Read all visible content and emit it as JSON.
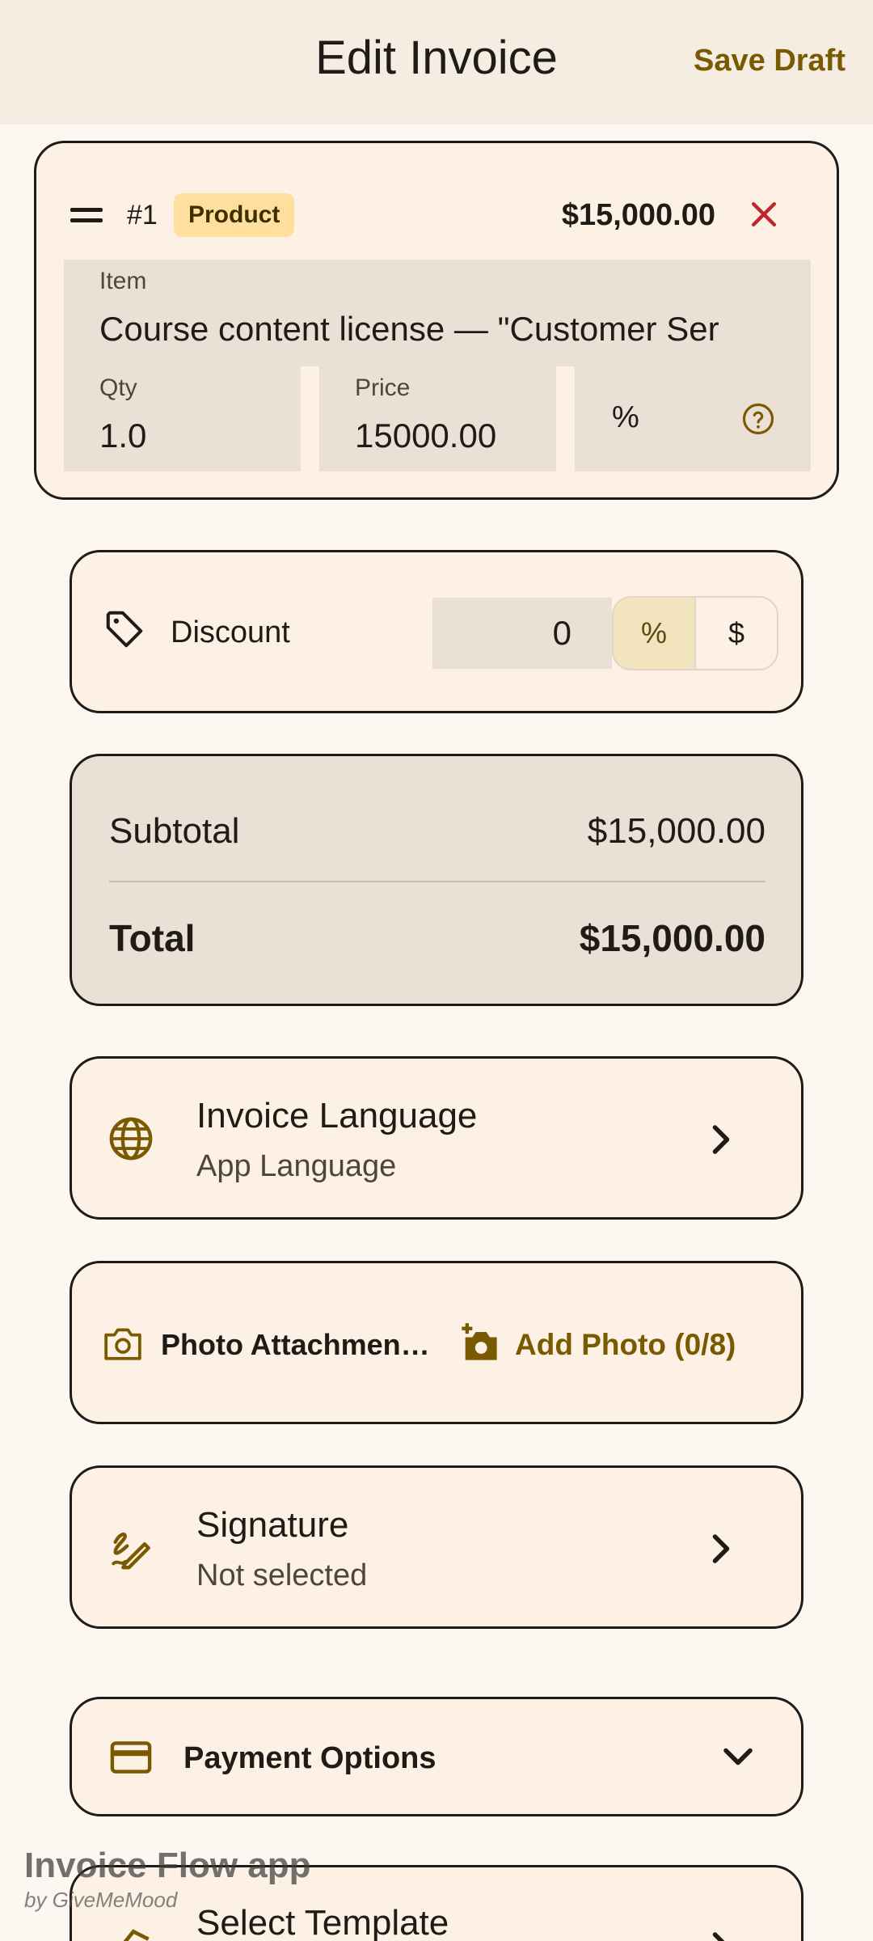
{
  "header": {
    "title": "Edit Invoice",
    "save_draft": "Save Draft"
  },
  "item": {
    "number": "#1",
    "type_badge": "Product",
    "amount": "$15,000.00",
    "item_label": "Item",
    "item_value": "Course content license — \"Customer Ser",
    "qty_label": "Qty",
    "qty_value": "1.0",
    "price_label": "Price",
    "price_value": "15000.00",
    "tax_symbol": "%"
  },
  "discount": {
    "label": "Discount",
    "value": "0",
    "pct": "%",
    "usd": "$"
  },
  "totals": {
    "subtotal_label": "Subtotal",
    "subtotal_value": "$15,000.00",
    "total_label": "Total",
    "total_value": "$15,000.00"
  },
  "language": {
    "title": "Invoice Language",
    "subtitle": "App Language"
  },
  "photos": {
    "title": "Photo Attachmen…",
    "add_label": "Add Photo (0/8)"
  },
  "signature": {
    "title": "Signature",
    "subtitle": "Not selected"
  },
  "payment": {
    "title": "Payment Options"
  },
  "template": {
    "title": "Select Template"
  },
  "watermark": {
    "title": "Invoice Flow app",
    "subtitle": "by GiveMeMood"
  },
  "colors": {
    "accent": "#7a5a00",
    "danger": "#c0262d",
    "badge": "#ffdf9e",
    "surface": "#fdf0e4"
  }
}
